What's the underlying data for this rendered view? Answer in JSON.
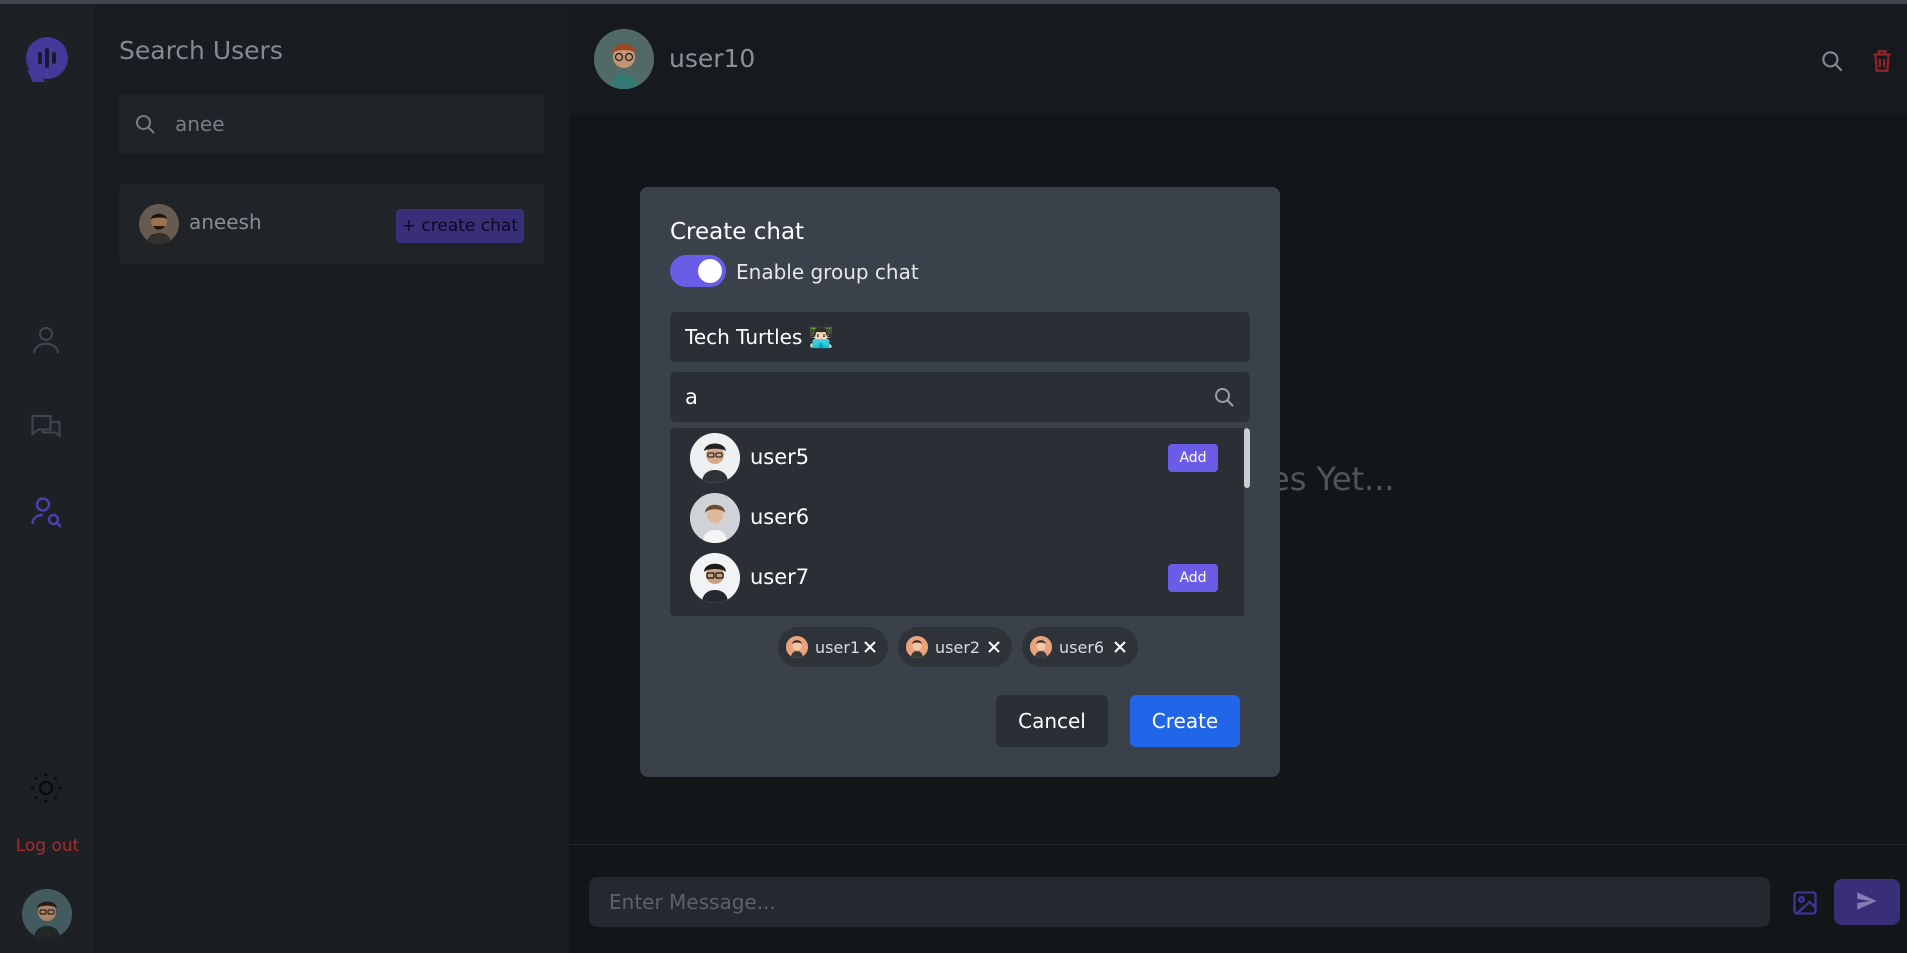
{
  "sidebar": {
    "logout_label": "Log out",
    "icons": [
      "logo-icon",
      "user-icon",
      "chats-icon",
      "user-search-icon",
      "sun-icon"
    ]
  },
  "search_panel": {
    "title": "Search Users",
    "search_value": "anee",
    "results": [
      {
        "name": "aneesh",
        "action_label": "+ create chat"
      }
    ]
  },
  "chat": {
    "header_name": "user10",
    "empty_text": "es Yet...",
    "message_placeholder": "Enter Message..."
  },
  "modal": {
    "title": "Create chat",
    "toggle_label": "Enable group chat",
    "toggle_on": true,
    "group_name_value": "Tech Turtles 👨🏻‍💻",
    "user_search_value": "a",
    "users": [
      {
        "name": "user5",
        "add_label": "Add",
        "show_add": true
      },
      {
        "name": "user6",
        "add_label": "",
        "show_add": false
      },
      {
        "name": "user7",
        "add_label": "Add",
        "show_add": true
      }
    ],
    "selected": [
      {
        "name": "user1"
      },
      {
        "name": "user2"
      },
      {
        "name": "user6"
      }
    ],
    "cancel_label": "Cancel",
    "create_label": "Create"
  },
  "colors": {
    "accent": "#6b5ce7",
    "primary_button": "#2166e8",
    "logout": "#c53434",
    "trash": "#b02a2a"
  }
}
